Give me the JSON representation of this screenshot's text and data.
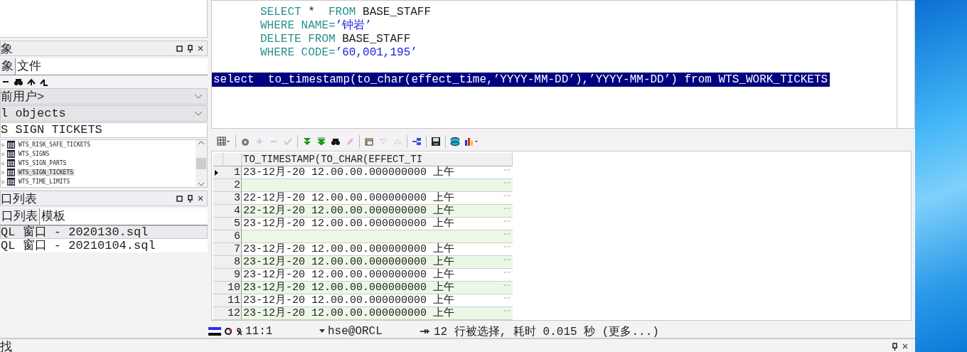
{
  "object_browser": {
    "title": "象",
    "tabs": [
      {
        "label": "象",
        "selected": true
      },
      {
        "label": "文件",
        "selected": false
      }
    ],
    "user_filter": "前用户>",
    "type_filter": "l objects",
    "search": "S SIGN TICKETS",
    "tree": [
      {
        "name": "WTS_RISK_SAFE_TICKETS",
        "selected": false
      },
      {
        "name": "WTS_SIGNS",
        "selected": false
      },
      {
        "name": "WTS_SIGN_PARTS",
        "selected": false
      },
      {
        "name": "WTS_SIGN_TICKETS",
        "selected": true
      },
      {
        "name": "WTS_TIME_LIMITS",
        "selected": false
      }
    ]
  },
  "window_list": {
    "title": "口列表",
    "tabs": [
      {
        "label": "口列表",
        "selected": true
      },
      {
        "label": "模板",
        "selected": false
      }
    ],
    "items": [
      {
        "label": "QL 窗口 - 2020130.sql",
        "selected": true
      },
      {
        "label": "QL 窗口 - 20210104.sql",
        "selected": false
      }
    ]
  },
  "editor": {
    "lines": [
      {
        "selected": false,
        "segments": [
          {
            "kind": "keyword",
            "text": "SELECT"
          },
          {
            "kind": "plain",
            "text": " *  "
          },
          {
            "kind": "keyword",
            "text": "FROM"
          },
          {
            "kind": "plain",
            "text": " BASE_STAFF"
          }
        ]
      },
      {
        "selected": false,
        "segments": [
          {
            "kind": "keyword",
            "text": "WHERE NAME="
          },
          {
            "kind": "string",
            "text": "’钟岩’"
          }
        ]
      },
      {
        "selected": false,
        "segments": [
          {
            "kind": "keyword",
            "text": "DELETE FROM"
          },
          {
            "kind": "plain",
            "text": " BASE_STAFF"
          }
        ]
      },
      {
        "selected": false,
        "segments": [
          {
            "kind": "keyword",
            "text": "WHERE CODE="
          },
          {
            "kind": "string",
            "text": "’60,001,195’"
          }
        ]
      },
      {
        "selected": false
      },
      {
        "selected": true,
        "segments": [
          {
            "kind": "plain",
            "text": "select  to_timestamp(to_char(effect_time,’YYYY-MM-DD’),’YYYY-MM-DD’) from WTS_WORK_TICKETS"
          }
        ]
      }
    ]
  },
  "results": {
    "column": "TO_TIMESTAMP(TO_CHAR(EFFECT_TI",
    "rows": [
      {
        "number": "1",
        "value": "23-12月-20 12.00.00.000000000 上午",
        "current": true
      },
      {
        "number": "2",
        "current": false
      },
      {
        "number": "3",
        "value": "22-12月-20 12.00.00.000000000 上午",
        "current": false
      },
      {
        "number": "4",
        "value": "22-12月-20 12.00.00.000000000 上午",
        "current": false
      },
      {
        "number": "5",
        "value": "23-12月-20 12.00.00.000000000 上午",
        "current": false
      },
      {
        "number": "6",
        "current": false
      },
      {
        "number": "7",
        "value": "23-12月-20 12.00.00.000000000 上午",
        "current": false
      },
      {
        "number": "8",
        "value": "23-12月-20 12.00.00.000000000 上午",
        "current": false
      },
      {
        "number": "9",
        "value": "23-12月-20 12.00.00.000000000 上午",
        "current": false
      },
      {
        "number": "10",
        "value": "23-12月-20 12.00.00.000000000 上午",
        "current": false
      },
      {
        "number": "11",
        "value": "23-12月-20 12.00.00.000000000 上午",
        "current": false
      },
      {
        "number": "12",
        "value": "23-12月-20 12.00.00.000000000 上午",
        "current": false
      }
    ]
  },
  "status_bar": {
    "position": "11:1",
    "connection": "hse@ORCL",
    "message": "12 行被选择, 耗时 0.015 秒 (更多...)"
  },
  "find_panel": {
    "title": "找"
  }
}
